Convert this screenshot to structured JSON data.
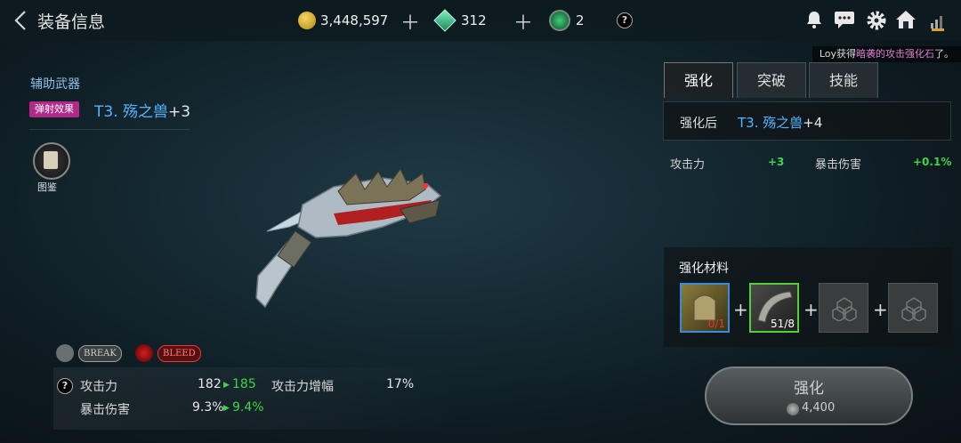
{
  "header": {
    "title": "装备信息",
    "gold": "3,448,597",
    "gems": "312",
    "emblems": "2",
    "help": "?"
  },
  "notice": {
    "prefix": "Loy获得",
    "highlight": "暗袭的攻击强化石",
    "suffix": "了。"
  },
  "item": {
    "category": "辅助武器",
    "effect_tag": "弹射效果",
    "name": "T3. 殇之兽",
    "level": "+3",
    "codex_label": "图鉴"
  },
  "effects": [
    {
      "label": "BREAK",
      "color": "#c9d0d2"
    },
    {
      "label": "BLEED",
      "color": "#e03b3b"
    }
  ],
  "stats": {
    "help": "?",
    "attack_label": "攻击力",
    "attack_current": "182",
    "attack_next": "185",
    "atk_boost_label": "攻击力增幅",
    "atk_boost_value": "17%",
    "crit_label": "暴击伤害",
    "crit_current": "9.3%",
    "crit_next": "9.4%"
  },
  "tabs": [
    {
      "label": "强化",
      "active": true
    },
    {
      "label": "突破",
      "active": false
    },
    {
      "label": "技能",
      "active": false
    }
  ],
  "upgrade": {
    "after_label": "强化后",
    "after_name": "T3. 殇之兽",
    "after_level": "+4",
    "bonus": [
      {
        "label": "攻击力",
        "value": "+3"
      },
      {
        "label": "暴击伤害",
        "value": "+0.1%"
      }
    ],
    "materials_label": "强化材料",
    "materials": [
      {
        "count": "0/1",
        "count_color": "#e03b3b",
        "border": "#3a8adf"
      },
      {
        "count": "51/8",
        "count_color": "#ffffff",
        "border": "#4fcf3a"
      }
    ],
    "button_label": "强化",
    "cost": "4,400"
  }
}
